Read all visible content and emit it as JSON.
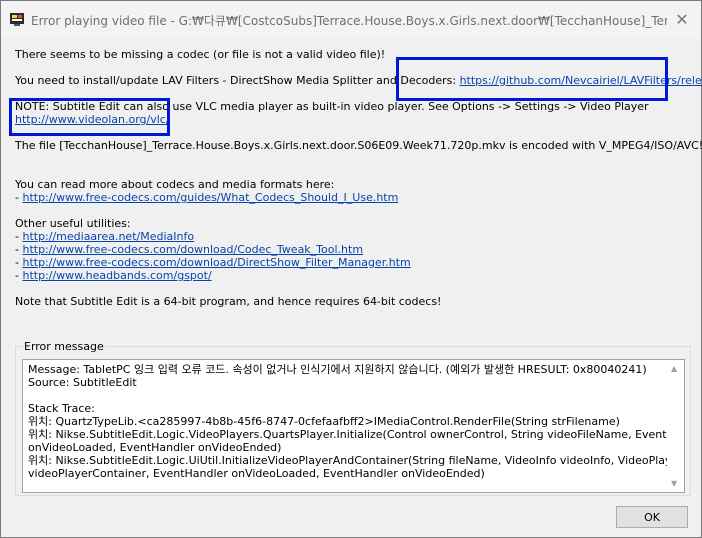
{
  "window": {
    "title": "Error playing video file - G:₩다큐₩[CostcoSubs]Terrace.House.Boys.x.Girls.next.door₩[TecchanHouse]_Terrace.Hous...",
    "close_icon": "close-icon",
    "app_icon": "subtitle-edit-icon"
  },
  "messages": {
    "missing_codec": "There seems to be missing a codec (or file is not a valid video file)!",
    "lav_text": "You need to install/update LAV Filters - DirectShow Media Splitter and Decoders: ",
    "lav_link": "https://github.com/Nevcairiel/LAVFilters/releases",
    "note_text": "NOTE: Subtitle Edit can also use VLC media player as built-in video player. See Options -> Settings -> Video Player",
    "vlc_link": "http://www.videolan.org/vlc/",
    "file_info": "The file [TecchanHouse]_Terrace.House.Boys.x.Girls.next.door.S06E09.Week71.720p.mkv is encoded with V_MPEG4/ISO/AVC!",
    "read_more": "You can read more about codecs and media formats here:",
    "read_more_prefix": " - ",
    "read_more_link": "http://www.free-codecs.com/guides/What_Codecs_Should_I_Use.htm",
    "utilities_heading": "Other useful utilities:",
    "utility_prefix": " - ",
    "utilities": [
      "http://mediaarea.net/MediaInfo",
      "http://www.free-codecs.com/download/Codec_Tweak_Tool.htm",
      "http://www.free-codecs.com/download/DirectShow_Filter_Manager.htm",
      "http://www.headbands.com/gspot/"
    ],
    "bitness_note": "Note that Subtitle Edit is a 64-bit program, and hence requires 64-bit codecs!"
  },
  "error_group": {
    "label": "Error message",
    "lines": [
      "Message: TabletPC 잉크 입력 오류 코드. 속성이 없거나 인식기에서 지원하지 않습니다. (예외가 발생한 HRESULT: 0x80040241)",
      "Source: SubtitleEdit",
      "",
      "Stack Trace:",
      "   위치: QuartzTypeLib.<ca285997-4b8b-45f6-8747-0cfefaafbff2>IMediaControl.RenderFile(String strFilename)",
      "   위치: Nikse.SubtitleEdit.Logic.VideoPlayers.QuartsPlayer.Initialize(Control ownerControl, String videoFileName, EventHandler",
      "onVideoLoaded, EventHandler onVideoEnded)",
      "   위치: Nikse.SubtitleEdit.Logic.UiUtil.InitializeVideoPlayerAndContainer(String fileName, VideoInfo videoInfo, VideoPlayerContainer",
      "videoPlayerContainer, EventHandler onVideoLoaded, EventHandler onVideoEnded)"
    ]
  },
  "buttons": {
    "ok_label": "OK"
  },
  "colors": {
    "highlight": "#0018d6",
    "link": "#0645ad"
  }
}
